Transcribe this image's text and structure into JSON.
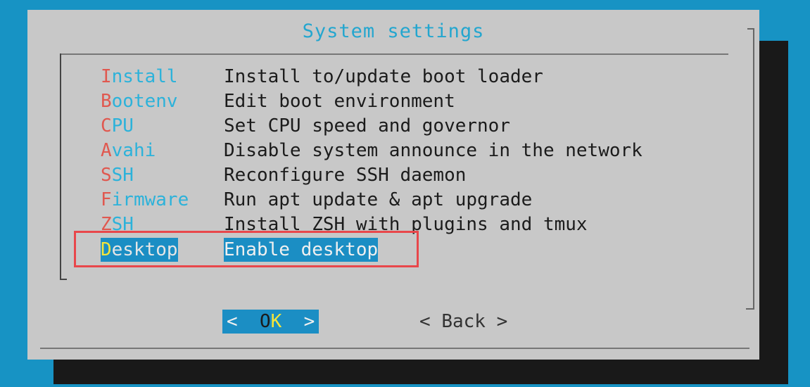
{
  "dialog": {
    "title": "System settings"
  },
  "menu": {
    "items": [
      {
        "hotkey": "I",
        "rest": "nstall",
        "desc": "Install to/update boot loader"
      },
      {
        "hotkey": "B",
        "rest": "ootenv",
        "desc": "Edit boot environment"
      },
      {
        "hotkey": "C",
        "rest": "PU",
        "desc": "Set CPU speed and governor"
      },
      {
        "hotkey": "A",
        "rest": "vahi",
        "desc": "Disable system announce in the network"
      },
      {
        "hotkey": "S",
        "rest": "SH",
        "desc": "Reconfigure SSH daemon"
      },
      {
        "hotkey": "F",
        "rest": "irmware",
        "desc": "Run apt update & apt upgrade"
      },
      {
        "hotkey": "Z",
        "rest": "SH",
        "desc": "Install ZSH with plugins and tmux"
      },
      {
        "hotkey": "D",
        "rest": "esktop",
        "desc": "Enable desktop"
      }
    ],
    "selected_index": 7
  },
  "buttons": {
    "ok": {
      "left": "<  ",
      "pre": "O",
      "hot": "K",
      "right": "  >"
    },
    "back": {
      "left": "< ",
      "label": "Back",
      "right": " >"
    }
  },
  "colors": {
    "background": "#1793c4",
    "dialog": "#c8c8c8",
    "title": "#23a6cf",
    "hotkey": "#e0584f",
    "tag": "#2cb2da",
    "selection": "#1b8ec4",
    "highlight_outline": "#e8474b"
  }
}
